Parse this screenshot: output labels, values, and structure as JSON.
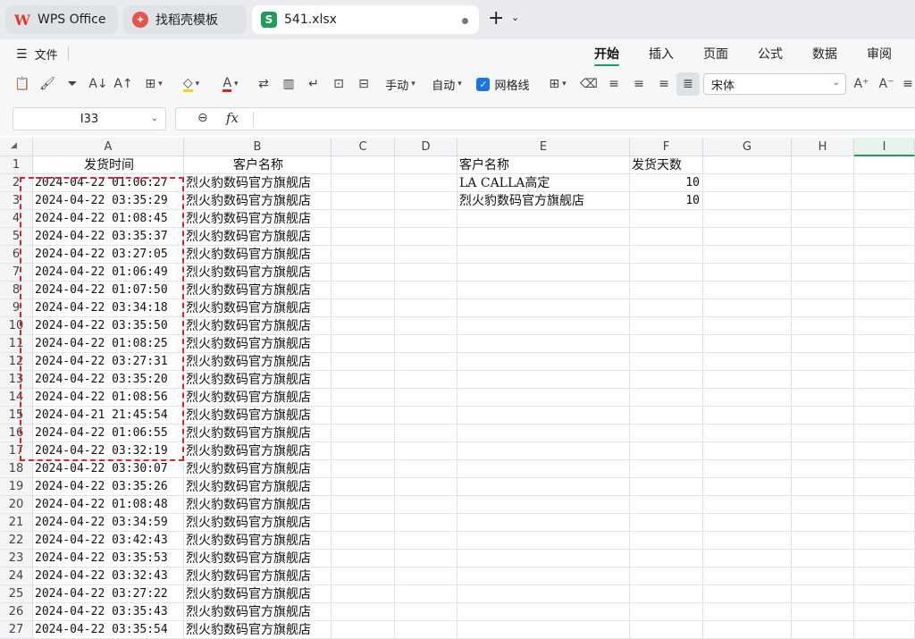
{
  "tabs": [
    {
      "label": "WPS Office",
      "icon": "wps-logo-icon"
    },
    {
      "label": "找稻壳模板",
      "icon": "docer-logo-icon"
    },
    {
      "label": "541.xlsx",
      "icon": "spreadsheet-icon"
    }
  ],
  "menu": {
    "file": "文件",
    "ribbon_tabs": [
      "开始",
      "插入",
      "页面",
      "公式",
      "数据",
      "审阅"
    ],
    "active_tab": "开始"
  },
  "toolbar": {
    "manual_label": "手动",
    "auto_label": "自动",
    "gridline_label": "网格线",
    "font_name": "宋体",
    "font_color": "#e02222",
    "fill_color": "#f5d31c",
    "accent": "#1e9c5a"
  },
  "formula_bar": {
    "cell_ref": "I33",
    "fx": "fx",
    "content": ""
  },
  "sheet": {
    "columns": [
      "A",
      "B",
      "C",
      "D",
      "E",
      "F",
      "G",
      "H",
      "I"
    ],
    "selected_column": "I",
    "rows": [
      {
        "n": "1",
        "a": "发货时间",
        "b": "客户名称",
        "e": "客户名称",
        "f": "发货天数"
      },
      {
        "n": "2",
        "a": "2024-04-22 01:06:27",
        "b": "烈火豹数码官方旗舰店",
        "e": "LA CALLA高定",
        "f": "10"
      },
      {
        "n": "3",
        "a": "2024-04-22 03:35:29",
        "b": "烈火豹数码官方旗舰店",
        "e": "烈火豹数码官方旗舰店",
        "f": "10"
      },
      {
        "n": "4",
        "a": "2024-04-22 01:08:45",
        "b": "烈火豹数码官方旗舰店"
      },
      {
        "n": "5",
        "a": "2024-04-22 03:35:37",
        "b": "烈火豹数码官方旗舰店"
      },
      {
        "n": "6",
        "a": "2024-04-22 03:27:05",
        "b": "烈火豹数码官方旗舰店"
      },
      {
        "n": "7",
        "a": "2024-04-22 01:06:49",
        "b": "烈火豹数码官方旗舰店"
      },
      {
        "n": "8",
        "a": "2024-04-22 01:07:50",
        "b": "烈火豹数码官方旗舰店"
      },
      {
        "n": "9",
        "a": "2024-04-22 03:34:18",
        "b": "烈火豹数码官方旗舰店"
      },
      {
        "n": "10",
        "a": "2024-04-22 03:35:50",
        "b": "烈火豹数码官方旗舰店"
      },
      {
        "n": "11",
        "a": "2024-04-22 01:08:25",
        "b": "烈火豹数码官方旗舰店"
      },
      {
        "n": "12",
        "a": "2024-04-22 03:27:31",
        "b": "烈火豹数码官方旗舰店"
      },
      {
        "n": "13",
        "a": "2024-04-22 03:35:20",
        "b": "烈火豹数码官方旗舰店"
      },
      {
        "n": "14",
        "a": "2024-04-22 01:08:56",
        "b": "烈火豹数码官方旗舰店"
      },
      {
        "n": "15",
        "a": "2024-04-21 21:45:54",
        "b": "烈火豹数码官方旗舰店"
      },
      {
        "n": "16",
        "a": "2024-04-22 01:06:55",
        "b": "烈火豹数码官方旗舰店"
      },
      {
        "n": "17",
        "a": "2024-04-22 03:32:19",
        "b": "烈火豹数码官方旗舰店"
      },
      {
        "n": "18",
        "a": "2024-04-22 03:30:07",
        "b": "烈火豹数码官方旗舰店"
      },
      {
        "n": "19",
        "a": "2024-04-22 03:35:26",
        "b": "烈火豹数码官方旗舰店"
      },
      {
        "n": "20",
        "a": "2024-04-22 01:08:48",
        "b": "烈火豹数码官方旗舰店"
      },
      {
        "n": "21",
        "a": "2024-04-22 03:34:59",
        "b": "烈火豹数码官方旗舰店"
      },
      {
        "n": "22",
        "a": "2024-04-22 03:42:43",
        "b": "烈火豹数码官方旗舰店"
      },
      {
        "n": "23",
        "a": "2024-04-22 03:35:53",
        "b": "烈火豹数码官方旗舰店"
      },
      {
        "n": "24",
        "a": "2024-04-22 03:32:43",
        "b": "烈火豹数码官方旗舰店"
      },
      {
        "n": "25",
        "a": "2024-04-22 03:27:22",
        "b": "烈火豹数码官方旗舰店"
      },
      {
        "n": "26",
        "a": "2024-04-22 03:35:43",
        "b": "烈火豹数码官方旗舰店"
      },
      {
        "n": "27",
        "a": "2024-04-22 03:35:54",
        "b": "烈火豹数码官方旗舰店"
      }
    ]
  }
}
